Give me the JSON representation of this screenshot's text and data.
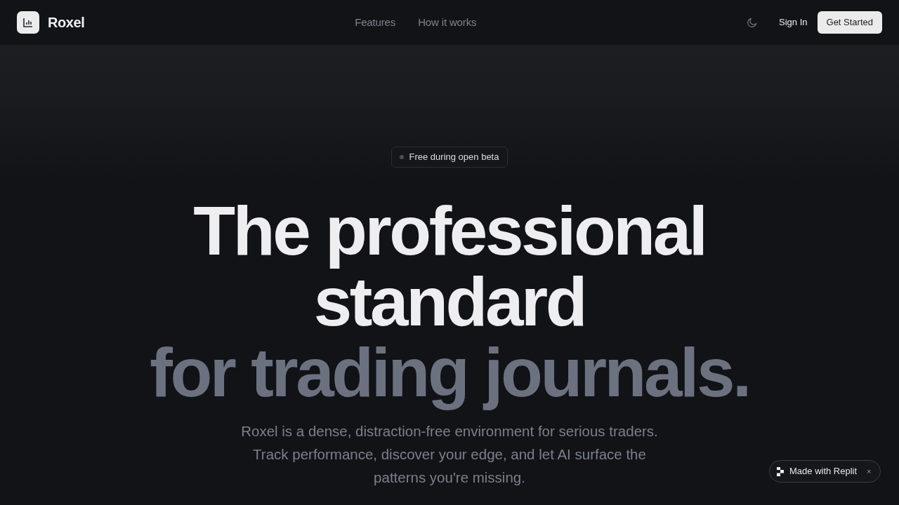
{
  "header": {
    "brand": "Roxel",
    "nav": [
      {
        "label": "Features"
      },
      {
        "label": "How it works"
      }
    ],
    "sign_in": "Sign In",
    "cta": "Get Started"
  },
  "hero": {
    "badge": "Free during open beta",
    "headline": "The professional standard",
    "headline_accent": "for trading journals.",
    "description": "Roxel is a dense, distraction-free environment for serious traders. Track performance, discover your edge, and let AI surface the patterns you're missing."
  },
  "replit_badge": {
    "label": "Made with Replit",
    "close": "×"
  }
}
